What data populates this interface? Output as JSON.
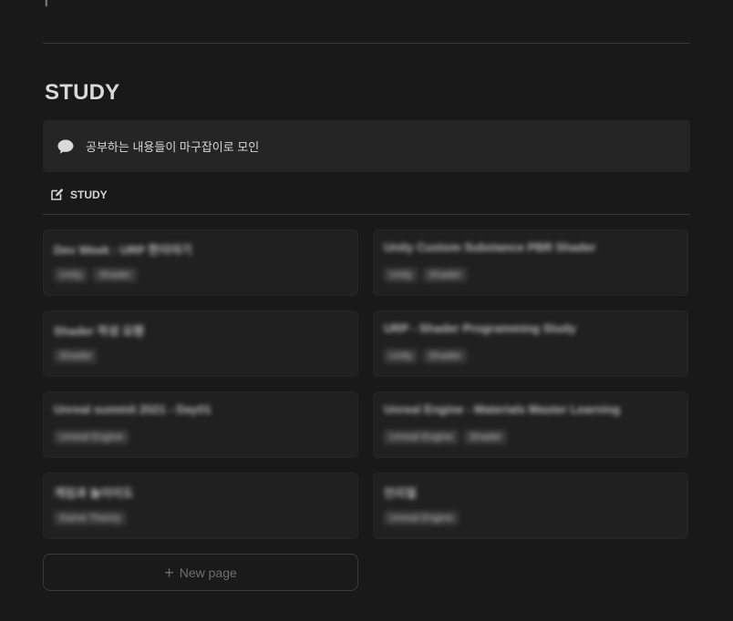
{
  "top_remnant": "|",
  "section": {
    "heading": "STUDY"
  },
  "callout": {
    "icon": "speech-bubble-icon",
    "text": "공부하는 내용들이 마구잡이로 모인"
  },
  "database": {
    "icon": "edit-icon",
    "title": "STUDY"
  },
  "cards": [
    {
      "title": "Dev Week : URP 한이야기",
      "tags": [
        "Unity",
        "Shader"
      ]
    },
    {
      "title": "Unity Custom Substance PBR Shader",
      "tags": [
        "Unity",
        "Shader"
      ]
    },
    {
      "title": "Shader 작성 요령",
      "tags": [
        "Shader"
      ]
    },
    {
      "title": "URP - Shader Programming Study",
      "tags": [
        "Unity",
        "Shader"
      ]
    },
    {
      "title": "Unreal summit 2021 - Day01",
      "tags": [
        "Unreal Engine"
      ]
    },
    {
      "title": "Unreal Engine - Materials Master Learning",
      "tags": [
        "Unreal Engine",
        "Shader"
      ]
    },
    {
      "title": "게임과 놀이이도",
      "tags": [
        "Game Theory"
      ]
    },
    {
      "title": "언리얼",
      "tags": [
        "Unreal Engine"
      ]
    }
  ],
  "new_page": {
    "icon": "plus-icon",
    "label": "New page"
  },
  "colors": {
    "background": "#191919",
    "card": "#202020",
    "callout": "#252525",
    "tag": "#3a3a3a"
  }
}
